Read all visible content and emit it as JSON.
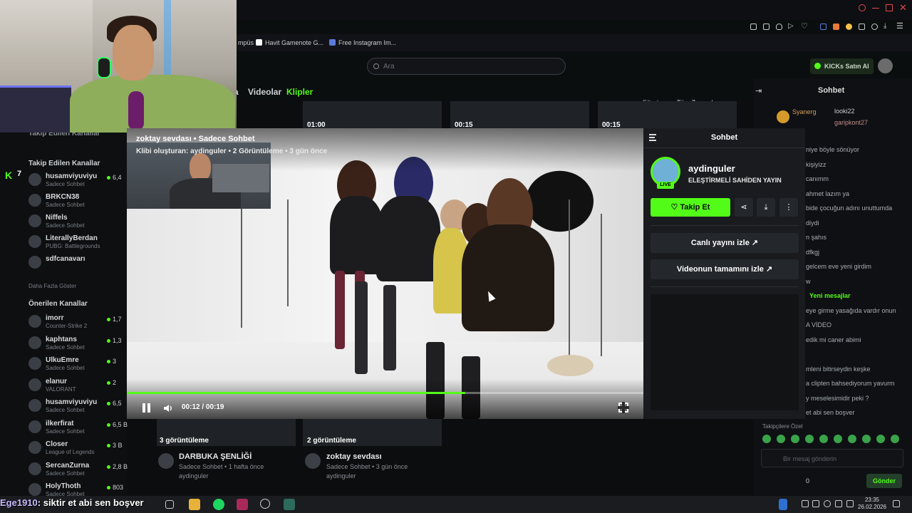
{
  "bookmarks": [
    {
      "label": "mpüs",
      "color": "#3d6edb"
    },
    {
      "label": "Havit Gamenote G...",
      "color": "#ffffff"
    },
    {
      "label": "Free Instagram Im...",
      "color": "#5b7bdb"
    }
  ],
  "header": {
    "search_placeholder": "Ara",
    "kicks_button": "KICKs Satın Al"
  },
  "tabs": {
    "videos": "Videolar",
    "clips": "Klipler",
    "partial": "a"
  },
  "kick_logo": "K",
  "kick_count": "7",
  "sidebar": {
    "partial_top": "Takip Edilen Kanallar",
    "followed_title": "Takip Edilen Kanallar",
    "followed": [
      {
        "name": "husamviyuviyu",
        "sub": "Sadece Sohbet",
        "views": "6,4"
      },
      {
        "name": "BRKCN38",
        "sub": "Sadece Sohbet",
        "views": ""
      },
      {
        "name": "Niffels",
        "sub": "Sadece Sohbet",
        "views": ""
      },
      {
        "name": "LiterallyBerdan",
        "sub": "PUBG: Battlegrounds",
        "views": ""
      },
      {
        "name": "sdfcanavarı",
        "sub": "",
        "views": ""
      }
    ],
    "show_more": "Daha Fazla Göster",
    "recommended_title": "Önerilen Kanallar",
    "recommended": [
      {
        "name": "imorr",
        "sub": "Counter-Strike 2",
        "views": "1,7"
      },
      {
        "name": "kaphtans",
        "sub": "Sadece Sohbet",
        "views": "1,3"
      },
      {
        "name": "UlkuEmre",
        "sub": "Sadece Sohbet",
        "views": "3"
      },
      {
        "name": "elanur",
        "sub": "VALORANT",
        "views": "2"
      },
      {
        "name": "husamviyuviyu",
        "sub": "Sadece Sohbet",
        "views": "6,5"
      },
      {
        "name": "ilkerfirat",
        "sub": "Sadece Sohbet",
        "views": "6,5 B"
      },
      {
        "name": "Closer",
        "sub": "League of Legends",
        "views": "3 B"
      },
      {
        "name": "SercanZurna",
        "sub": "Sadece Sohbet",
        "views": "2,8 B"
      },
      {
        "name": "HolyThoth",
        "sub": "Sadece Sohbet",
        "views": "803"
      }
    ]
  },
  "filter_label": "Filtrele:",
  "filter_value": "Tüm Zamanlar",
  "thumbs_top": [
    "01:00",
    "00:15",
    "00:15"
  ],
  "bg_clips": [
    {
      "views": "3 görüntüleme",
      "title": "DARBUKA ŞENLİĞİ",
      "sub": "Sadece Sohbet • 1 hafta önce",
      "author": "aydinguler"
    },
    {
      "views": "2 görüntüleme",
      "title": "zoktay sevdası",
      "sub": "Sadece Sohbet • 3 gün önce",
      "author": "aydinguler"
    }
  ],
  "clip": {
    "title": "zoktay sevdası • Sadece Sohbet",
    "meta": "Klibi oluşturan: aydinguler • 2 Görüntüleme • 3 gün önce",
    "time": "00:12 / 00:19",
    "progress": 0.655
  },
  "chat_panel": {
    "title": "Sohbet",
    "channel": "aydinguler",
    "stream_title": "ELEŞTİRMELİ SAHİDEN YAYIN",
    "live": "LIVE",
    "follow": "Takip Et",
    "watch_live": "Canlı yayını izle",
    "watch_full": "Videonun tamamını izle"
  },
  "bg_chat": {
    "title": "Sohbet",
    "users": [
      "Syanerg",
      "looki22",
      "garipkont27"
    ],
    "messages": [
      "niye böyle sönüyor",
      "kişiyizz",
      "canımm",
      "ahmet lazım ya",
      "bide çocuğun adını unuttumda",
      "diydi",
      "n şahıs",
      "dfkgj",
      "gelcem eve yeni girdim",
      "w",
      "Yeni mesajlar",
      "eye girme yasağıda vardır onun",
      "A VİDEO",
      "edik mi caner abimi",
      "",
      "mleni bitirseydin keşke",
      "a clipten bahsediyorum yavurm",
      "y meselesimidir peki ?",
      "et abi sen boşver"
    ],
    "followers_only": "Takipçilere Özel",
    "input_placeholder": "Bir mesaj gönderin",
    "send": "Gönder",
    "count": "0"
  },
  "overlay": {
    "user": "Ege1910",
    "text": "siktir et abi sen boşver"
  },
  "clock": {
    "time": "23:35",
    "date": "26.02.2026"
  },
  "colors": {
    "accent": "#53fc18",
    "bg": "#0b0e0f",
    "panel": "#191b1f"
  }
}
